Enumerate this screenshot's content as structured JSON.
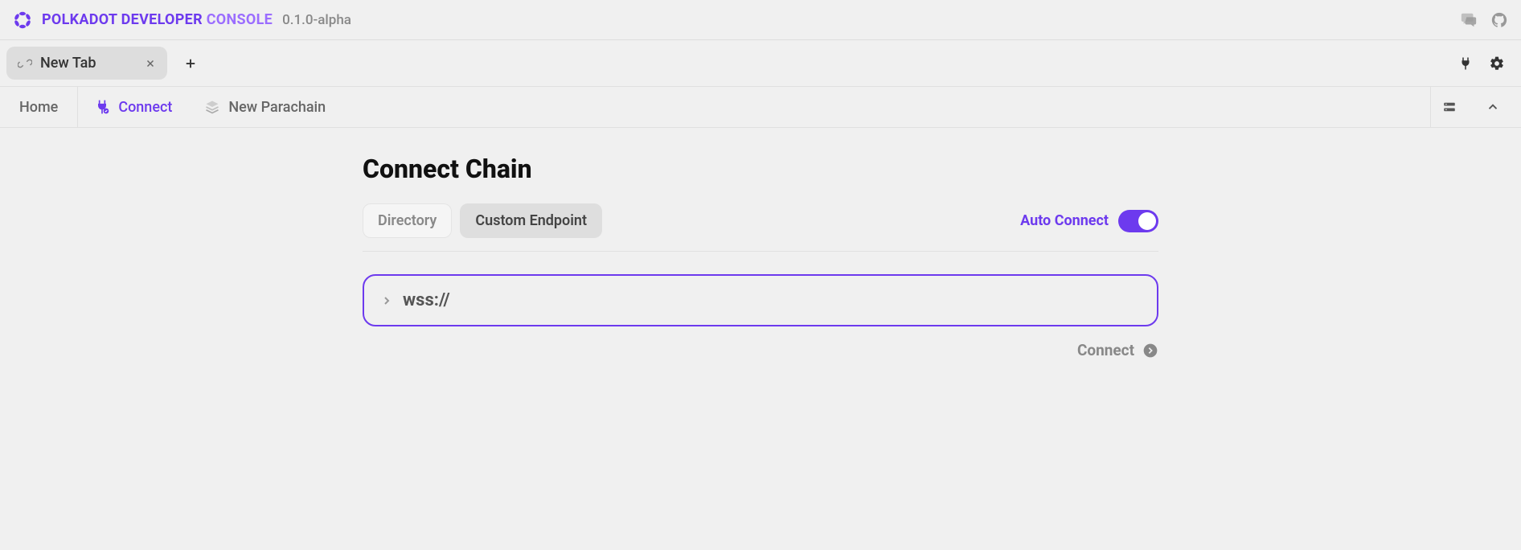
{
  "header": {
    "brand_part1": "POLKADOT DEVELOPER ",
    "brand_part2": "CONSOLE",
    "version": "0.1.0-alpha"
  },
  "tabs": {
    "items": [
      {
        "label": "New Tab"
      }
    ]
  },
  "subnav": {
    "home": "Home",
    "connect": "Connect",
    "new_parachain": "New Parachain"
  },
  "main": {
    "title": "Connect Chain",
    "mode_tabs": {
      "directory": "Directory",
      "custom_endpoint": "Custom Endpoint"
    },
    "auto_connect_label": "Auto Connect",
    "auto_connect_enabled": true,
    "endpoint_value": "wss://",
    "connect_button": "Connect"
  },
  "colors": {
    "accent": "#6d3aee"
  }
}
